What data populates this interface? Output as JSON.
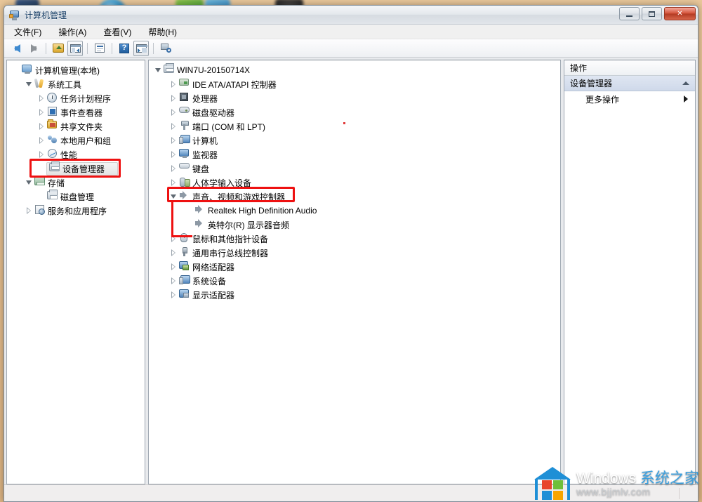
{
  "window": {
    "title": "计算机管理",
    "icon": "computer-management-icon",
    "minimize_label": "",
    "maximize_label": "",
    "close_label": "✕"
  },
  "menubar": {
    "items": [
      {
        "label": "文件(F)",
        "name": "menu-file"
      },
      {
        "label": "操作(A)",
        "name": "menu-action"
      },
      {
        "label": "查看(V)",
        "name": "menu-view"
      },
      {
        "label": "帮助(H)",
        "name": "menu-help"
      }
    ]
  },
  "toolbar": {
    "buttons": [
      {
        "name": "back-button",
        "icon": "left-arrow-icon"
      },
      {
        "name": "forward-button",
        "icon": "right-arrow-icon"
      },
      {
        "name": "up-one-level-button",
        "icon": "folder-up-icon"
      },
      {
        "name": "show-hide-tree-button",
        "icon": "console-tree-icon"
      },
      {
        "name": "properties-button",
        "icon": "properties-icon"
      },
      {
        "name": "help-button",
        "icon": "question-mark-icon"
      },
      {
        "name": "show-action-pane-button",
        "icon": "action-pane-icon"
      },
      {
        "name": "scan-hardware-button",
        "icon": "scan-hardware-icon"
      }
    ]
  },
  "left_tree": {
    "items": [
      {
        "label": "计算机管理(本地)",
        "icon": "computer-icon",
        "indent": 0,
        "expander": "none",
        "selected": false
      },
      {
        "label": "系统工具",
        "icon": "system-tools-icon",
        "indent": 1,
        "expander": "open",
        "selected": false
      },
      {
        "label": "任务计划程序",
        "icon": "task-scheduler-icon",
        "indent": 2,
        "expander": "closed",
        "selected": false
      },
      {
        "label": "事件查看器",
        "icon": "event-viewer-icon",
        "indent": 2,
        "expander": "closed",
        "selected": false
      },
      {
        "label": "共享文件夹",
        "icon": "shared-folders-icon",
        "indent": 2,
        "expander": "closed",
        "selected": false
      },
      {
        "label": "本地用户和组",
        "icon": "local-users-icon",
        "indent": 2,
        "expander": "closed",
        "selected": false
      },
      {
        "label": "性能",
        "icon": "performance-icon",
        "indent": 2,
        "expander": "closed",
        "selected": false
      },
      {
        "label": "设备管理器",
        "icon": "device-manager-icon",
        "indent": 2,
        "expander": "none",
        "selected": true
      },
      {
        "label": "存储",
        "icon": "storage-icon",
        "indent": 1,
        "expander": "open",
        "selected": false
      },
      {
        "label": "磁盘管理",
        "icon": "disk-management-icon",
        "indent": 2,
        "expander": "none",
        "selected": false
      },
      {
        "label": "服务和应用程序",
        "icon": "services-apps-icon",
        "indent": 1,
        "expander": "closed",
        "selected": false
      }
    ]
  },
  "device_tree": {
    "items": [
      {
        "label": "WIN7U-20150714X",
        "icon": "computer-root-icon",
        "indent": 0,
        "expander": "open"
      },
      {
        "label": "IDE ATA/ATAPI 控制器",
        "icon": "ide-controller-icon",
        "indent": 1,
        "expander": "closed"
      },
      {
        "label": "处理器",
        "icon": "processor-icon",
        "indent": 1,
        "expander": "closed"
      },
      {
        "label": "磁盘驱动器",
        "icon": "disk-drive-icon",
        "indent": 1,
        "expander": "closed"
      },
      {
        "label": "端口 (COM 和 LPT)",
        "icon": "ports-icon",
        "indent": 1,
        "expander": "closed"
      },
      {
        "label": "计算机",
        "icon": "computer-node-icon",
        "indent": 1,
        "expander": "closed"
      },
      {
        "label": "监视器",
        "icon": "monitor-icon",
        "indent": 1,
        "expander": "closed"
      },
      {
        "label": "键盘",
        "icon": "keyboard-icon",
        "indent": 1,
        "expander": "closed"
      },
      {
        "label": "人体学输入设备",
        "icon": "hid-icon",
        "indent": 1,
        "expander": "closed"
      },
      {
        "label": "声音、视频和游戏控制器",
        "icon": "sound-controller-icon",
        "indent": 1,
        "expander": "open"
      },
      {
        "label": "Realtek High Definition Audio",
        "icon": "audio-device-icon",
        "indent": 2,
        "expander": "none"
      },
      {
        "label": "英特尔(R) 显示器音频",
        "icon": "audio-device-icon",
        "indent": 2,
        "expander": "none"
      },
      {
        "label": "鼠标和其他指针设备",
        "icon": "mouse-icon",
        "indent": 1,
        "expander": "closed"
      },
      {
        "label": "通用串行总线控制器",
        "icon": "usb-controller-icon",
        "indent": 1,
        "expander": "closed"
      },
      {
        "label": "网络适配器",
        "icon": "network-adapter-icon",
        "indent": 1,
        "expander": "closed"
      },
      {
        "label": "系统设备",
        "icon": "system-device-icon",
        "indent": 1,
        "expander": "closed"
      },
      {
        "label": "显示适配器",
        "icon": "display-adapter-icon",
        "indent": 1,
        "expander": "closed"
      }
    ]
  },
  "actions_pane": {
    "title": "操作",
    "section": "设备管理器",
    "section_chevron": "chevron-up-icon",
    "rows": [
      {
        "label": "更多操作",
        "chevron": "chevron-right-icon"
      }
    ]
  },
  "statusbar": {
    "text": ""
  },
  "watermark": {
    "brand_en": "Windows ",
    "brand_cn": "系统之家",
    "url": "www.bjjmlv.com"
  },
  "colors": {
    "annotation_red": "#ee1111",
    "selection_blue": "#cfd9ea",
    "desktop": "#e3bd8e"
  }
}
